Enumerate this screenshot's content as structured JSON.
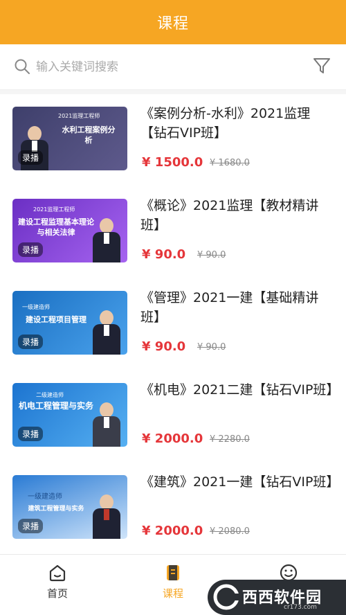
{
  "header": {
    "title": "课程"
  },
  "search": {
    "placeholder": "输入关键词搜索"
  },
  "courses": [
    {
      "title": "《案例分析-水利》2021监理【钻石VIP班】",
      "price": "¥ 1500.0",
      "original_price": "¥ 1680.0",
      "thumb": {
        "banner": "2021监理工程师",
        "title": "水利工程案例分析",
        "badge": "录播",
        "bg1": "#3e3f6b",
        "bg2": "#5e5a8c"
      }
    },
    {
      "title": "《概论》2021监理【教材精讲班】",
      "price": "¥ 90.0",
      "original_price": "¥ 90.0",
      "thumb": {
        "banner": "2021监理工程师",
        "title": "建设工程监理基本理论与相关法律",
        "badge": "录播",
        "bg1": "#6b2fc4",
        "bg2": "#a664f0"
      }
    },
    {
      "title": "《管理》2021一建【基础精讲班】",
      "price": "¥ 90.0",
      "original_price": "¥ 90.0",
      "thumb": {
        "banner": "一级建造师",
        "title": "建设工程项目管理",
        "badge": "录播",
        "bg1": "#1a6fc2",
        "bg2": "#4aa2ec"
      }
    },
    {
      "title": "《机电》2021二建【钻石VIP班】",
      "price": "¥ 2000.0",
      "original_price": "¥ 2280.0",
      "thumb": {
        "banner": "二级建造师",
        "title": "机电工程管理与实务",
        "badge": "录播",
        "bg1": "#1c74d0",
        "bg2": "#56b0f2"
      }
    },
    {
      "title": "《建筑》2021一建【钻石VIP班】",
      "price": "¥ 2000.0",
      "original_price": "¥ 2080.0",
      "thumb": {
        "banner": "一级建造师",
        "title": "建筑工程管理与实务",
        "badge": "录播",
        "bg1": "#2a7bd4",
        "bg2": "#cfe4fa"
      }
    }
  ],
  "tabbar": {
    "items": [
      {
        "label": "首页",
        "icon": "home-icon",
        "color": "#333333"
      },
      {
        "label": "课程",
        "icon": "course-icon",
        "color": "#F6A623"
      },
      {
        "label": "我的",
        "icon": "smile-icon",
        "color": "#333333"
      }
    ]
  },
  "watermark": {
    "text": "西西软件园",
    "sub": "cr173.com"
  },
  "colors": {
    "accent": "#F6A623",
    "price": "#E5363A"
  }
}
